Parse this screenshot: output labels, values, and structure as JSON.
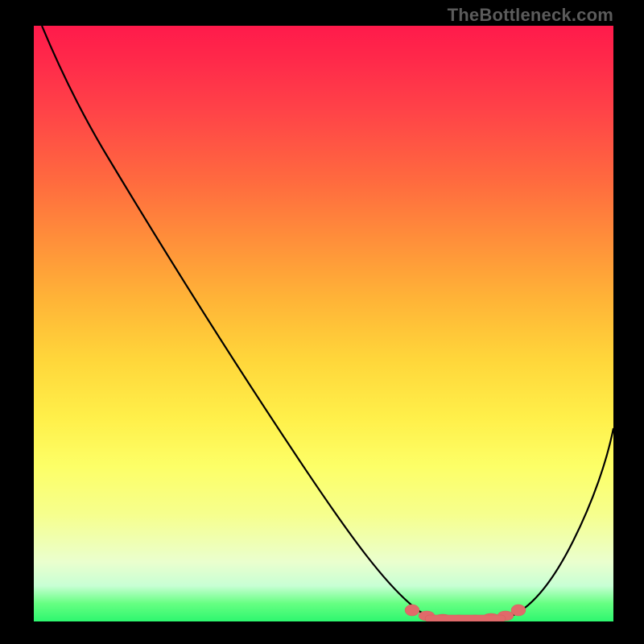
{
  "watermark": "TheBottleneck.com",
  "chart_data": {
    "type": "line",
    "title": "",
    "xlabel": "",
    "ylabel": "",
    "xlim": [
      0,
      100
    ],
    "ylim": [
      0,
      100
    ],
    "x": [
      0,
      5,
      10,
      15,
      20,
      25,
      30,
      35,
      40,
      45,
      50,
      55,
      60,
      65,
      68,
      70,
      72,
      74,
      76,
      78,
      80,
      82,
      84,
      86,
      88,
      90,
      92,
      94,
      96,
      98,
      100
    ],
    "values": [
      100,
      96,
      91,
      85,
      78,
      71,
      63,
      55,
      48,
      40,
      33,
      26,
      19,
      12,
      8,
      6,
      4,
      3,
      2,
      1.3,
      1,
      1,
      1.3,
      2,
      4,
      7,
      11,
      16,
      22,
      29,
      36
    ],
    "flat_region": {
      "x_start": 68,
      "x_end": 84
    },
    "flat_markers_x": [
      68,
      70,
      72,
      74,
      76,
      78,
      80,
      82,
      84
    ]
  },
  "colors": {
    "curve": "#000000",
    "marker": "#e06a6a",
    "background_border": "#000000"
  }
}
